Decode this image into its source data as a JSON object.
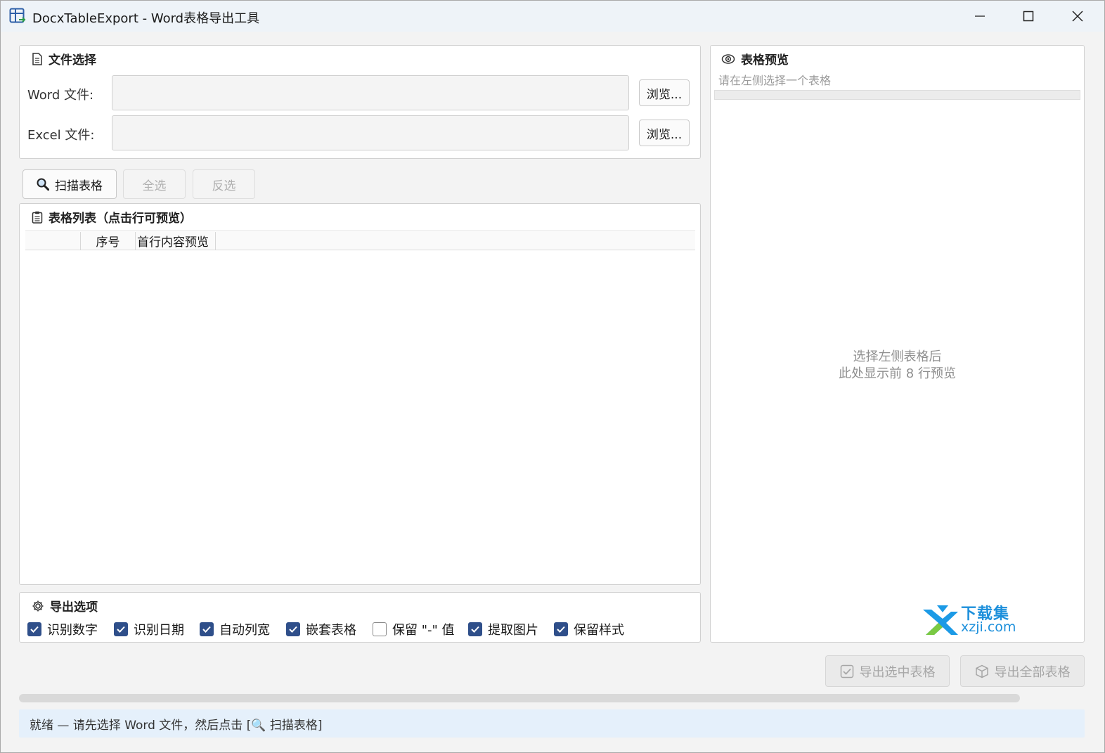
{
  "window": {
    "title": "DocxTableExport - Word表格导出工具"
  },
  "file_section": {
    "header": "文件选择",
    "word_label": "Word 文件:",
    "word_value": "",
    "excel_label": "Excel 文件:",
    "excel_value": "",
    "browse_label": "浏览..."
  },
  "toolbar": {
    "scan_label": "扫描表格",
    "select_all_label": "全选",
    "invert_label": "反选"
  },
  "table_list": {
    "header": "表格列表（点击行可预览）",
    "columns": [
      "",
      "序号",
      "首行内容预览"
    ]
  },
  "options": {
    "header": "导出选项",
    "items": [
      {
        "label": "识别数字",
        "checked": true
      },
      {
        "label": "识别日期",
        "checked": true
      },
      {
        "label": "自动列宽",
        "checked": true
      },
      {
        "label": "嵌套表格",
        "checked": true
      },
      {
        "label": "保留 \"-\" 值",
        "checked": false
      },
      {
        "label": "提取图片",
        "checked": true
      },
      {
        "label": "保留样式",
        "checked": true
      }
    ]
  },
  "preview": {
    "header": "表格预览",
    "hint": "请在左侧选择一个表格",
    "placeholder_line1": "选择左侧表格后",
    "placeholder_line2": "此处显示前 8 行预览"
  },
  "watermark": {
    "brand_cn": "下载集",
    "brand_url": "xzji.com"
  },
  "actions": {
    "export_selected_label": "导出选中表格",
    "export_all_label": "导出全部表格"
  },
  "progress": {
    "percent": 0
  },
  "status": {
    "text": "就绪 — 请先选择 Word 文件，然后点击 [🔍 扫描表格]"
  },
  "colors": {
    "accent": "#2f4f8a",
    "status_bg": "#e5f0fb",
    "titlebar_bg": "#eef3f8"
  }
}
